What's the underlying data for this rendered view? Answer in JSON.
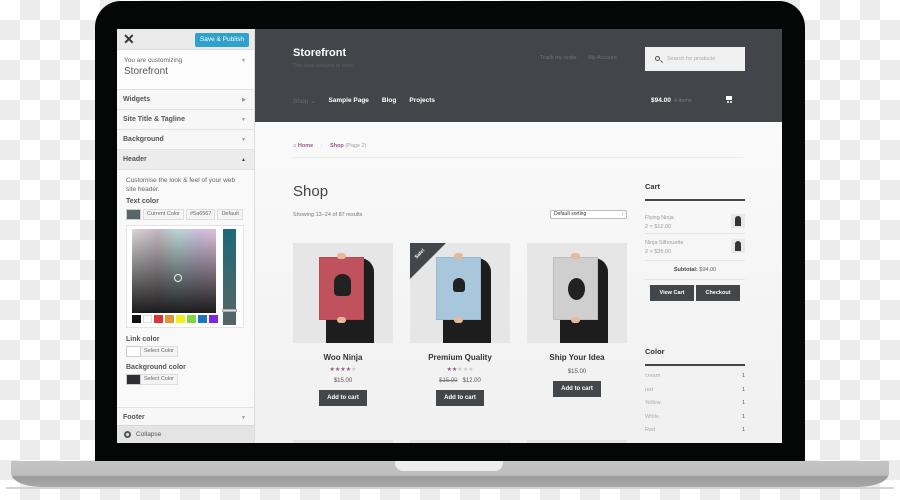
{
  "customizer": {
    "publish_label": "Save & Publish",
    "customizing_label": "You are customizing",
    "theme_name": "Storefront",
    "sections": [
      {
        "label": "Widgets"
      },
      {
        "label": "Site Title & Tagline"
      },
      {
        "label": "Background"
      },
      {
        "label": "Header"
      },
      {
        "label": "Footer"
      }
    ],
    "header_panel": {
      "description": "Customise the look & feel of your web site header.",
      "text_color": {
        "label": "Text color",
        "current_color_label": "Current Color",
        "hex_value": "#5a6567",
        "default_label": "Default",
        "swatch": "#5a6567",
        "palette": [
          "#111111",
          "#ffffff",
          "#dd3333",
          "#dd9933",
          "#eeee22",
          "#81d742",
          "#1e73be",
          "#8224e3"
        ]
      },
      "link_color": {
        "label": "Link color",
        "select_label": "Select Color",
        "swatch": "#ffffff"
      },
      "background_color": {
        "label": "Background color",
        "select_label": "Select Color",
        "swatch": "#2d2f35"
      }
    },
    "collapse_label": "Collapse"
  },
  "site": {
    "title": "Storefront",
    "tagline": "The best widgets in town",
    "top_links": [
      "Track my order",
      "My Account"
    ],
    "search_placeholder": "Search for products",
    "nav": [
      {
        "label": "Shop"
      },
      {
        "label": "Sample Page"
      },
      {
        "label": "Blog"
      },
      {
        "label": "Projects"
      }
    ],
    "cart_total": "$94.00",
    "cart_items": "4 items",
    "breadcrumb": {
      "home": "Home",
      "shop": "Shop",
      "page": "(Page 2)"
    },
    "page_title": "Shop",
    "result_count": "Showing 13–24 of 87 results",
    "sorting": "Default sorting",
    "products": [
      {
        "name": "Woo Ninja",
        "rating": 4,
        "rating_max": 5,
        "price": "$15.00",
        "old_price": null,
        "sale": false,
        "button": "Add to cart",
        "poster_color": "#c0525e"
      },
      {
        "name": "Premium Quality",
        "rating": 2,
        "rating_max": 5,
        "price": "$12.00",
        "old_price": "$15.00",
        "sale": true,
        "sale_label": "Sale!",
        "button": "Add to cart",
        "poster_color": "#a9c7dc"
      },
      {
        "name": "Ship Your Idea",
        "rating": null,
        "price": "$15.00",
        "old_price": null,
        "sale": false,
        "button": "Add to cart",
        "poster_color": "#cfcfcf"
      }
    ],
    "cart_widget": {
      "title": "Cart",
      "items": [
        {
          "name": "Flying Ninja",
          "qty_price": "2 × $12.00"
        },
        {
          "name": "Ninja Silhouette",
          "qty_price": "2 × $35.00"
        }
      ],
      "subtotal_label": "Subtotal:",
      "subtotal_value": "$94.00",
      "view_cart": "View Cart",
      "checkout": "Checkout"
    },
    "color_widget": {
      "title": "Color",
      "items": [
        {
          "name": "cream",
          "count": "1"
        },
        {
          "name": "red",
          "count": "1"
        },
        {
          "name": "Yellow",
          "count": "1"
        },
        {
          "name": "White",
          "count": "1"
        },
        {
          "name": "Red",
          "count": "1"
        }
      ]
    }
  }
}
